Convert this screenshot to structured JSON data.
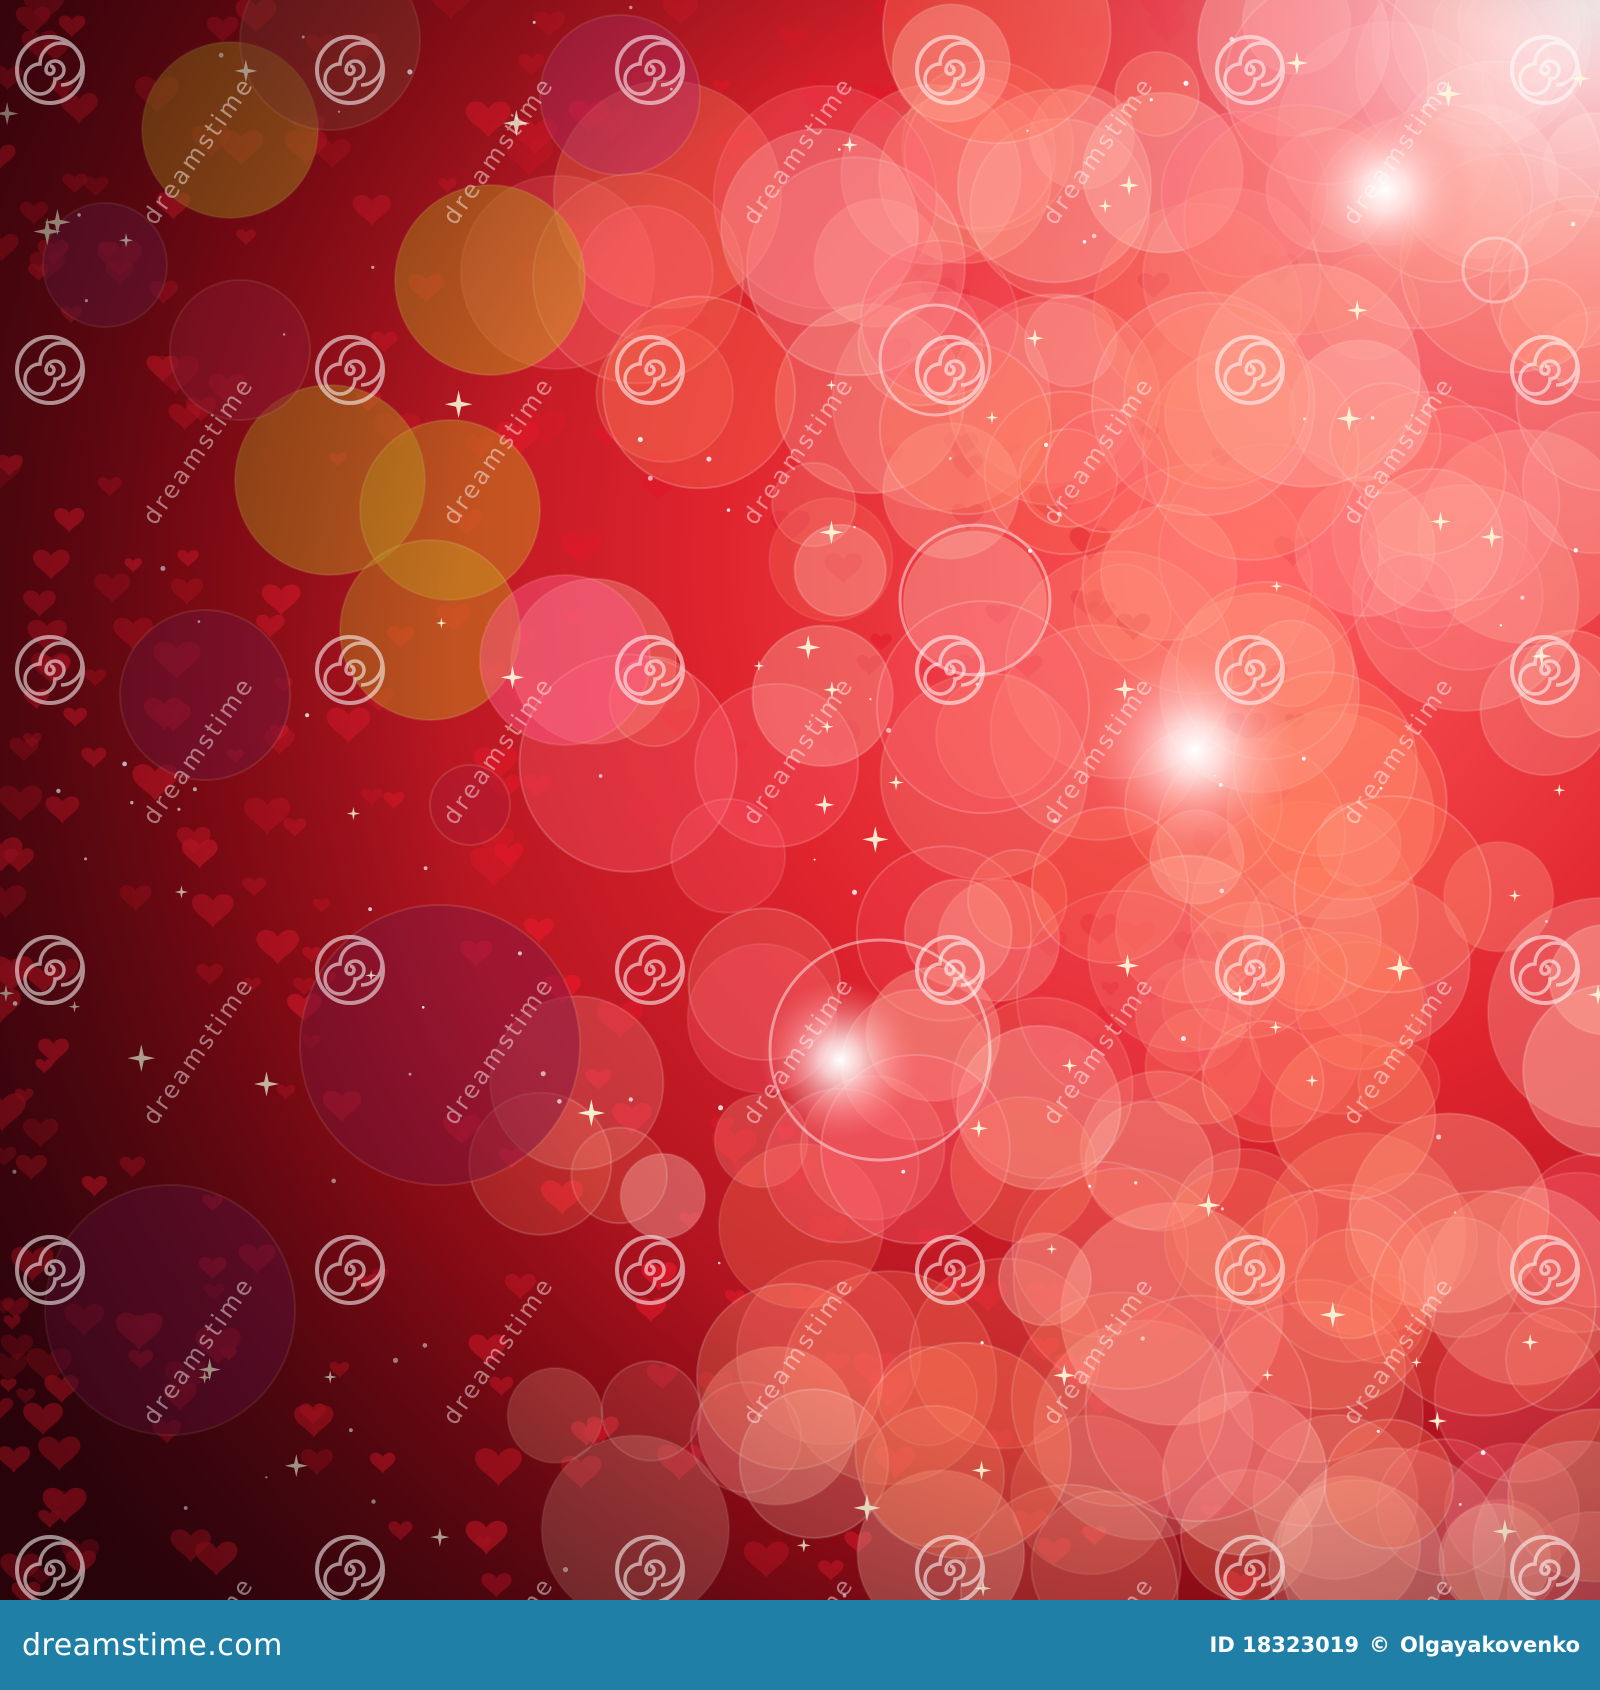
{
  "image": {
    "description_tags": [
      "red-bokeh",
      "hearts",
      "sparkles",
      "light-flare"
    ],
    "palette": {
      "background_dark": "#3a0610",
      "background_mid": "#a2101e",
      "bokeh_warm": "#ff6a4a",
      "bokeh_pink": "#ff5c8a",
      "bokeh_gold": "#c89a20",
      "heart": "#e0182a",
      "sparkle": "#fff6d8"
    }
  },
  "watermark": {
    "text": "dreamstime",
    "icon": "spiral-logo-icon"
  },
  "footer": {
    "logo_text": "dreamstime.com",
    "id_label": "ID 18323019",
    "copyright_symbol": "©",
    "author": "Olgayakovenko",
    "background_color": "#1f7fa7"
  }
}
